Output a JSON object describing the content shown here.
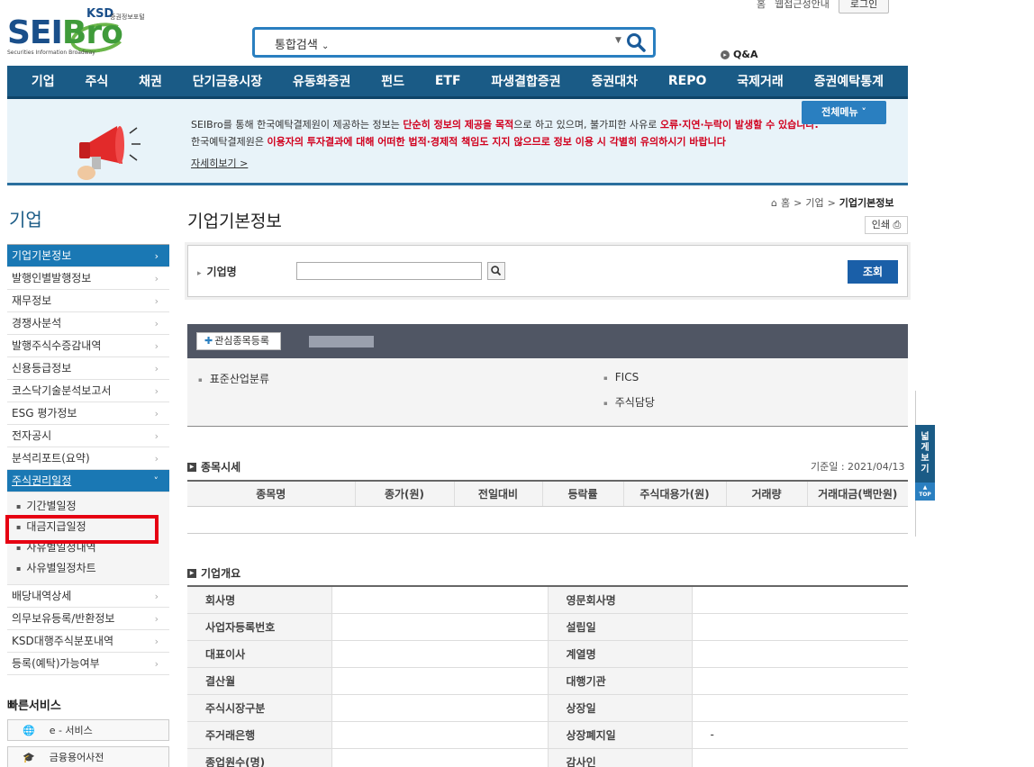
{
  "util": {
    "home": "홈",
    "sitemap": "웹접근성안내",
    "login": "로그인"
  },
  "logo": {
    "brand_a": "SEI",
    "brand_b": "Bro",
    "ksd": "KSD",
    "ksd_sub": "증권정보포털",
    "sub": "Securities Information Broadway"
  },
  "search": {
    "scope": "통합검색",
    "placeholder": "",
    "drop": "▼"
  },
  "qna": "Q&A",
  "gnb": [
    "기업",
    "주식",
    "채권",
    "단기금융시장",
    "유동화증권",
    "펀드",
    "ETF",
    "파생결합증권",
    "증권대차",
    "REPO",
    "국제거래",
    "증권예탁통계"
  ],
  "notice": {
    "l1_a": "SEIBro를 통해 한국예탁결제원이 제공하는 정보는 ",
    "l1_b": "단순히 정보의 제공을 목적",
    "l1_c": "으로 하고 있으며, 불가피한 사유로 ",
    "l1_d": "오류·지연·누락이 발생할 수 있습니다.",
    "l2_a": "한국예탁결제원은 ",
    "l2_b": "이용자의 투자결과에 대해 어떠한 법적·경제적 책임도 지지 않으므로 정보 이용 시 각별히 유의하시기 바랍니다",
    "more": "자세히보기  >",
    "menu_all": "전체메뉴  ˅"
  },
  "lnb": {
    "title": "기업",
    "items_top": [
      {
        "label": "기업기본정보",
        "active": true
      },
      {
        "label": "발행인별발행정보"
      },
      {
        "label": "재무정보"
      },
      {
        "label": "경쟁사분석"
      },
      {
        "label": "발행주식수증감내역"
      },
      {
        "label": "신용등급정보"
      },
      {
        "label": "코스닥기술분석보고서"
      },
      {
        "label": "ESG 평가정보"
      },
      {
        "label": "전자공시"
      },
      {
        "label": "분석리포트(요약)"
      }
    ],
    "rights": {
      "label": "주식권리일정",
      "arr": "˅"
    },
    "sub": [
      "기간별일정",
      "대금지급일정",
      "사유별일정내역",
      "사유별일정차트"
    ],
    "items_bottom": [
      "배당내역상세",
      "의무보유등록/반환정보",
      "KSD대행주식분포내역",
      "등록(예탁)가능여부"
    ],
    "arr": "›"
  },
  "quick": {
    "title": "빠른서비스",
    "items": [
      "e - 서비스",
      "금융용어사전"
    ]
  },
  "breadcrumb": {
    "home": "홈",
    "sep": ">",
    "l1": "기업",
    "cur": "기업기본정보"
  },
  "page_title": "기업기본정보",
  "print": "인쇄",
  "search_panel": {
    "label": "기업명",
    "value": "",
    "go": "조회"
  },
  "fav": {
    "label": "관심종목등록",
    "plus": "✚"
  },
  "industry": {
    "left": "표준산업분류",
    "right1": "FICS",
    "right2": "주식담당"
  },
  "price": {
    "title": "종목시세",
    "base_date": "기준일 : 2021/04/13",
    "headers": [
      "종목명",
      "종가(원)",
      "전일대비",
      "등락률",
      "주식대용가(원)",
      "거래량",
      "거래대금(백만원)"
    ]
  },
  "overview": {
    "title": "기업개요",
    "rows": [
      [
        "회사명",
        "",
        "영문회사명",
        ""
      ],
      [
        "사업자등록번호",
        "",
        "설립일",
        ""
      ],
      [
        "대표이사",
        "",
        "계열명",
        ""
      ],
      [
        "결산월",
        "",
        "대행기관",
        ""
      ],
      [
        "주식시장구분",
        "",
        "상장일",
        ""
      ],
      [
        "주거래은행",
        "",
        "상장폐지일",
        "-"
      ],
      [
        "종업원수(명)",
        "",
        "감사인",
        ""
      ]
    ]
  },
  "wide_tab": {
    "label": "넓게보기",
    "top": "TOP"
  }
}
